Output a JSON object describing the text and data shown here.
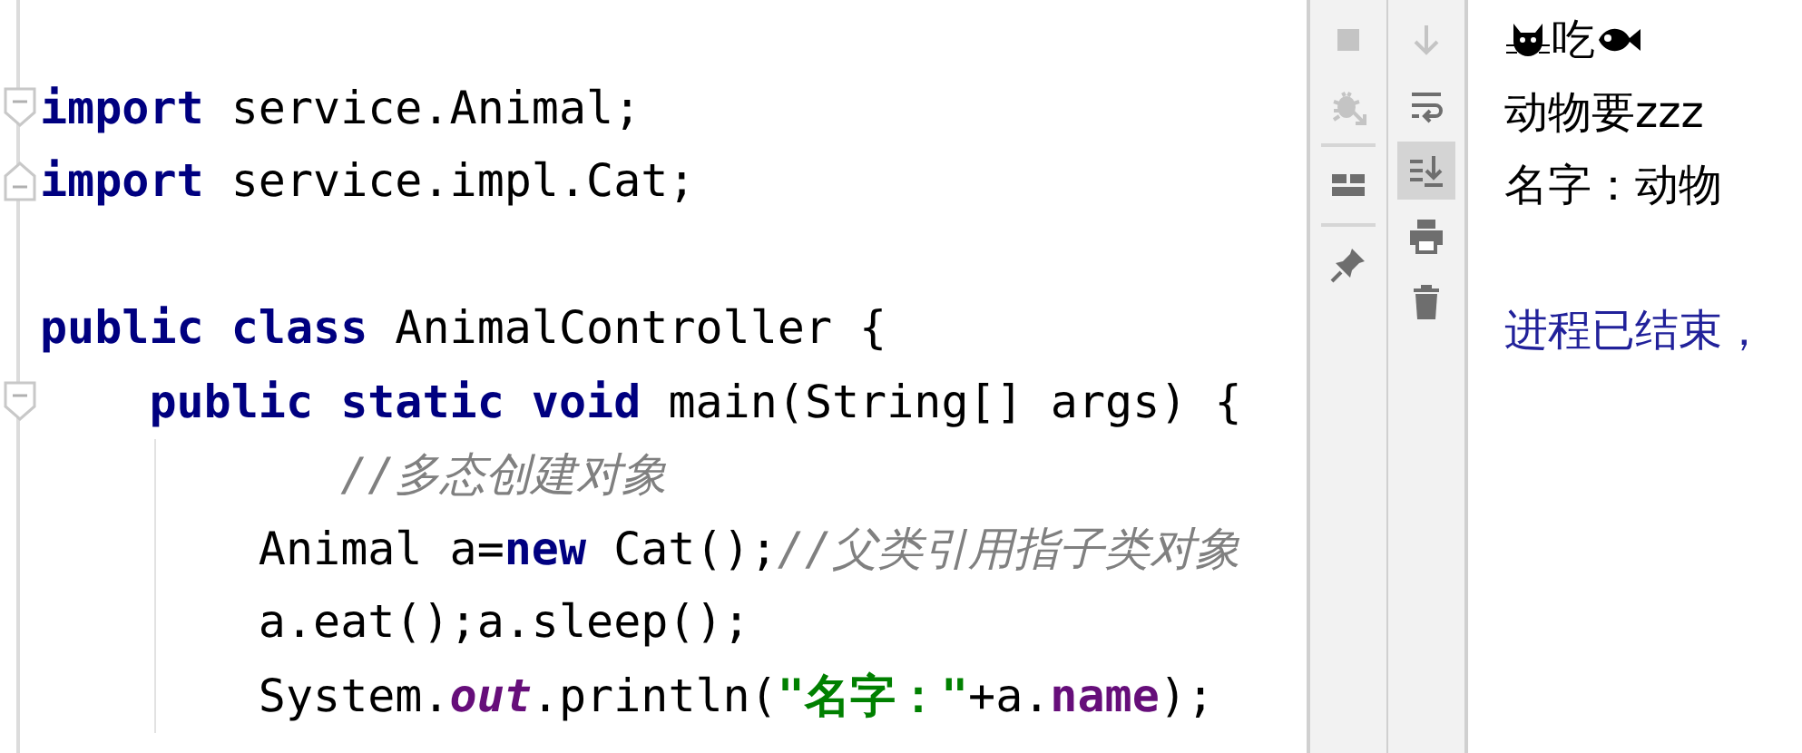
{
  "editor": {
    "lines": [
      {
        "fold_start": true,
        "fold_end": false,
        "guide": false,
        "tokens": [
          {
            "kind": "keyword",
            "text": "import"
          },
          {
            "kind": "plain",
            "text": " service.Animal;"
          }
        ]
      },
      {
        "fold_start": false,
        "fold_end": true,
        "guide": false,
        "tokens": [
          {
            "kind": "keyword",
            "text": "import"
          },
          {
            "kind": "plain",
            "text": " service.impl.Cat;"
          }
        ]
      },
      {
        "fold_start": false,
        "fold_end": false,
        "guide": false
      },
      {
        "fold_start": false,
        "fold_end": false,
        "guide": false,
        "tokens": [
          {
            "kind": "keyword",
            "text": "public class"
          },
          {
            "kind": "plain",
            "text": " AnimalController {"
          }
        ]
      },
      {
        "fold_start": true,
        "fold_end": false,
        "guide": false,
        "tokens": [
          {
            "kind": "keyword",
            "text": "    public static void"
          },
          {
            "kind": "plain",
            "text": " main(String[] args) {"
          }
        ]
      },
      {
        "fold_start": false,
        "fold_end": false,
        "guide": true,
        "tokens": [
          {
            "kind": "comment",
            "text": "           //多态创建对象"
          }
        ]
      },
      {
        "fold_start": false,
        "fold_end": false,
        "guide": true,
        "tokens": [
          {
            "kind": "plain",
            "text": "        Animal a="
          },
          {
            "kind": "keyword",
            "text": "new"
          },
          {
            "kind": "plain",
            "text": " Cat();"
          },
          {
            "kind": "comment",
            "text": "//父类引用指子类对象"
          }
        ]
      },
      {
        "fold_start": false,
        "fold_end": false,
        "guide": true,
        "tokens": [
          {
            "kind": "plain",
            "text": "        a.eat();a.sleep();"
          }
        ]
      },
      {
        "fold_start": false,
        "fold_end": false,
        "guide": true,
        "tokens": [
          {
            "kind": "plain",
            "text": "        System."
          },
          {
            "kind": "static",
            "text": "out"
          },
          {
            "kind": "plain",
            "text": ".println("
          },
          {
            "kind": "string",
            "text": "\"名字：\""
          },
          {
            "kind": "plain",
            "text": "+a."
          },
          {
            "kind": "field",
            "text": "name"
          },
          {
            "kind": "plain",
            "text": ");"
          }
        ]
      }
    ]
  },
  "toolbar": {
    "columns": [
      {
        "buttons": [
          {
            "kind": "stop",
            "disabled": true,
            "selected": false,
            "divider_after": false
          },
          {
            "kind": "bug",
            "disabled": true,
            "selected": false,
            "divider_after": true
          },
          {
            "kind": "layout",
            "disabled": false,
            "selected": false,
            "divider_after": true
          },
          {
            "kind": "pin",
            "disabled": false,
            "selected": false,
            "divider_after": false
          }
        ]
      },
      {
        "buttons": [
          {
            "kind": "down",
            "disabled": true,
            "selected": false,
            "divider_after": false
          },
          {
            "kind": "wrap",
            "disabled": false,
            "selected": false,
            "divider_after": false
          },
          {
            "kind": "scroll-end",
            "disabled": false,
            "selected": true,
            "divider_after": false
          },
          {
            "kind": "print",
            "disabled": false,
            "selected": false,
            "divider_after": false
          },
          {
            "kind": "trash",
            "disabled": false,
            "selected": false,
            "divider_after": false
          }
        ]
      }
    ]
  },
  "console": {
    "lines": [
      {
        "kind": "output",
        "parts": [
          {
            "kind": "cat"
          },
          {
            "kind": "text",
            "text": "吃"
          },
          {
            "kind": "fish"
          }
        ]
      },
      {
        "kind": "output",
        "parts": [
          {
            "kind": "text",
            "text": "动物要zzz"
          }
        ]
      },
      {
        "kind": "output",
        "parts": [
          {
            "kind": "text",
            "text": "名字：动物"
          }
        ]
      },
      {
        "kind": "blank"
      },
      {
        "kind": "exit",
        "parts": [
          {
            "kind": "text",
            "text": "进程已结束，"
          }
        ]
      }
    ]
  }
}
